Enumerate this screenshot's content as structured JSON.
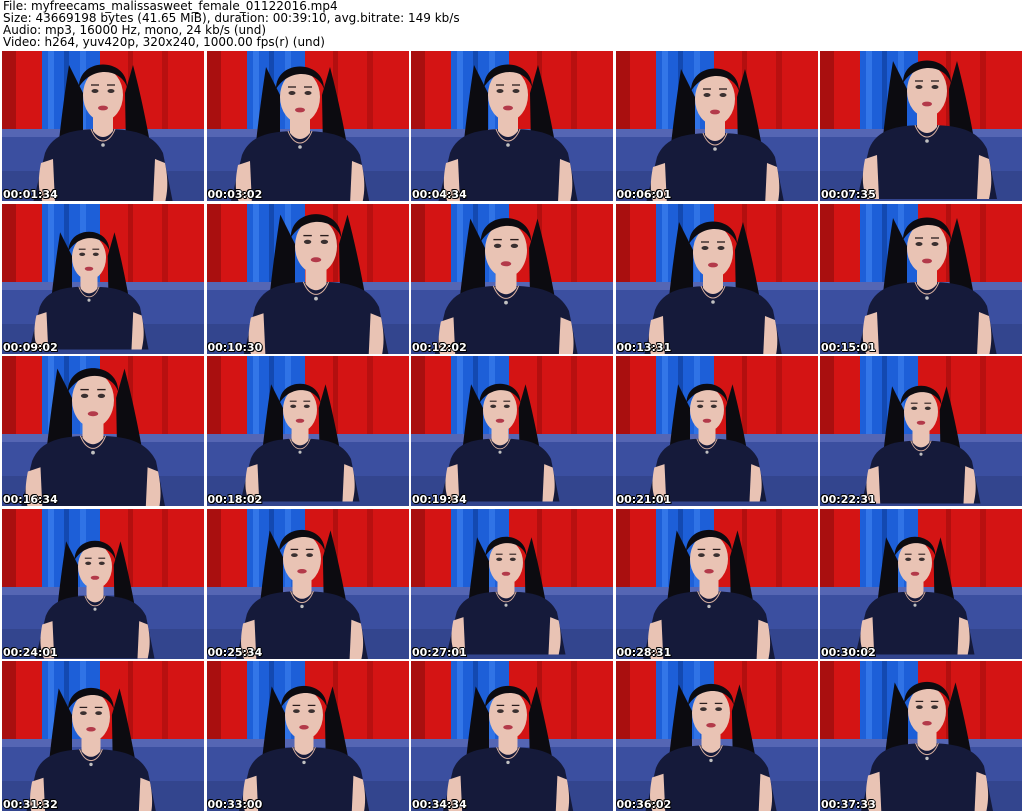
{
  "header": {
    "file_line": "File: myfreecams_malissasweet_female_01122016.mp4",
    "size_line": "Size: 43669198 bytes (41.65 MiB), duration: 00:39:10, avg.bitrate: 149 kb/s",
    "audio_line": "Audio: mp3, 16000 Hz, mono, 24 kb/s (und)",
    "video_line": "Video: h264, yuv420p, 320x240, 1000.00 fps(r) (und)"
  },
  "colors": {
    "curtain_red": "#d41414",
    "curtain_blue": "#1d5fd8",
    "sofa": "#3b4fa0",
    "hair": "#0c0b10",
    "skin": "#e9c3b4",
    "shirt": "#151a3a"
  },
  "thumbnails": [
    {
      "timestamp": "00:01:34"
    },
    {
      "timestamp": "00:03:02"
    },
    {
      "timestamp": "00:04:34"
    },
    {
      "timestamp": "00:06:01"
    },
    {
      "timestamp": "00:07:35"
    },
    {
      "timestamp": "00:09:02"
    },
    {
      "timestamp": "00:10:30"
    },
    {
      "timestamp": "00:12:02"
    },
    {
      "timestamp": "00:13:31"
    },
    {
      "timestamp": "00:15:01"
    },
    {
      "timestamp": "00:16:34"
    },
    {
      "timestamp": "00:18:02"
    },
    {
      "timestamp": "00:19:34"
    },
    {
      "timestamp": "00:21:01"
    },
    {
      "timestamp": "00:22:31"
    },
    {
      "timestamp": "00:24:01"
    },
    {
      "timestamp": "00:25:34"
    },
    {
      "timestamp": "00:27:01"
    },
    {
      "timestamp": "00:28:31"
    },
    {
      "timestamp": "00:30:02"
    },
    {
      "timestamp": "00:31:32"
    },
    {
      "timestamp": "00:33:00"
    },
    {
      "timestamp": "00:34:34"
    },
    {
      "timestamp": "00:36:02"
    },
    {
      "timestamp": "00:37:33"
    }
  ]
}
